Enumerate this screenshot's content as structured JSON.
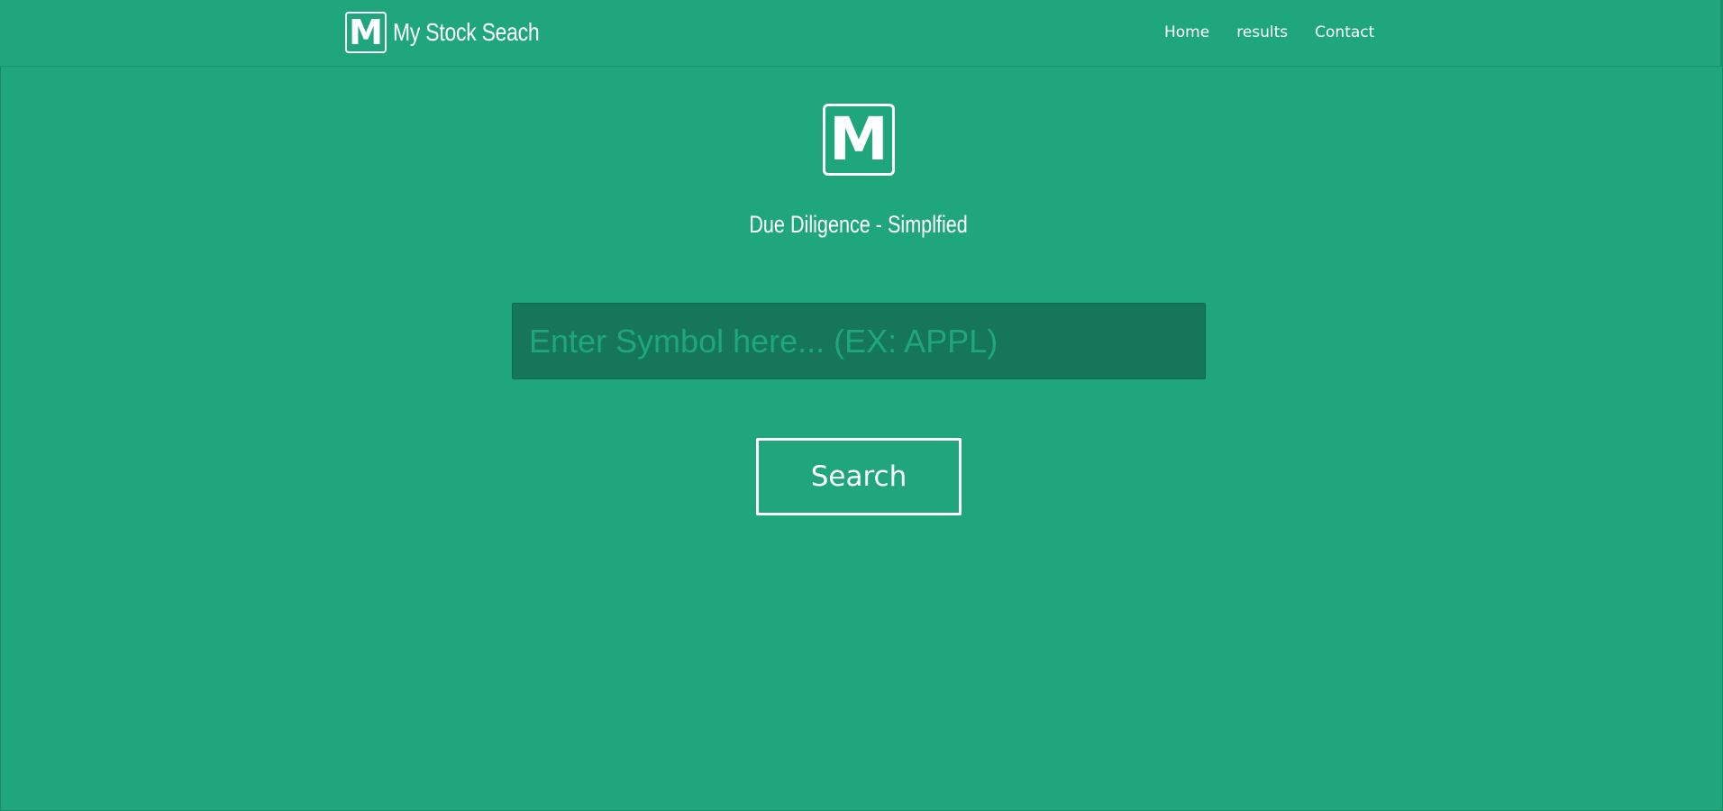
{
  "navbar": {
    "brand_logo_letter": "M",
    "brand_name": "My Stock Seach",
    "links": [
      {
        "label": "Home"
      },
      {
        "label": "results"
      },
      {
        "label": "Contact"
      }
    ]
  },
  "hero": {
    "logo_letter": "M",
    "tagline": "Due Diligence - Simplfied"
  },
  "search": {
    "placeholder": "Enter Symbol here... (EX: APPL)",
    "value": "",
    "button_label": "Search"
  },
  "colors": {
    "background": "#1fa77b",
    "input_background": "#15765a",
    "text": "#ffffff"
  }
}
